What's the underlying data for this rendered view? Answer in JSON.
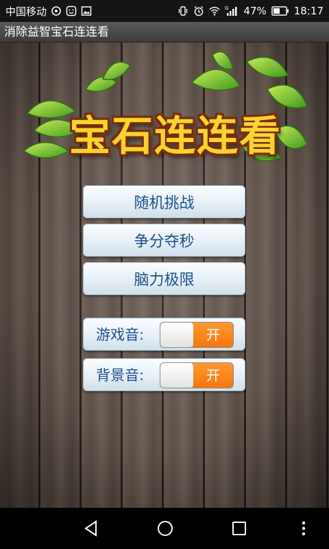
{
  "status_bar": {
    "carrier": "中国移动",
    "battery_percent": "47%",
    "time": "18:17",
    "signal_type": "G",
    "icons_left": [
      "nfc-icon",
      "smiley-icon",
      "image-icon"
    ],
    "icons_right": [
      "vibrate-icon",
      "alarm-icon",
      "wifi-icon",
      "signal-icon",
      "battery-icon"
    ]
  },
  "app": {
    "title": "消除益智宝石连连看",
    "logo_text": "宝石连连看"
  },
  "menu": {
    "items": [
      {
        "label": "随机挑战"
      },
      {
        "label": "争分夺秒"
      },
      {
        "label": "脑力极限"
      }
    ]
  },
  "settings": {
    "game_sound": {
      "label": "游戏音:",
      "state": "开"
    },
    "bg_music": {
      "label": "背景音:",
      "state": "开"
    }
  },
  "colors": {
    "accent_orange": "#f7841a",
    "button_text": "#1a4f8a",
    "logo_fill": "#f7d330"
  }
}
